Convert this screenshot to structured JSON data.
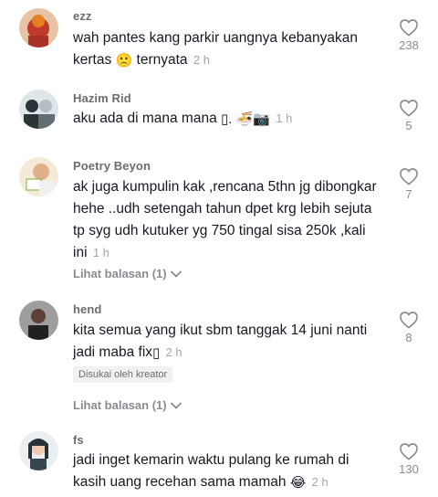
{
  "comments": [
    {
      "username": "ezz",
      "text": "wah pantes kang parkir uangnya kebanyakan kertas",
      "emoji": "🙁",
      "text_after": "ternyata",
      "time": "2 h",
      "likes": "238"
    },
    {
      "username": "Hazim Rid",
      "text": "aku ada di mana mana",
      "emoji": "▯. 🍜📷",
      "time": "1 h",
      "likes": "5"
    },
    {
      "username": "Poetry Beyon",
      "text": "ak juga kumpulin kak ,rencana 5thn jg dibongkar hehe ..udh setengah tahun dpet krg lebih sejuta tp syg udh kutuker yg 750 tingal sisa 250k ,kali ini",
      "time": "1 h",
      "likes": "7",
      "view_replies": "Lihat balasan (1)"
    },
    {
      "username": "hend",
      "text": "kita semua yang ikut sbm tanggak 14 juni nanti jadi maba fix",
      "emoji": "▯",
      "time": "2 h",
      "likes": "8",
      "badge": "Disukai oleh kreator",
      "view_replies": "Lihat balasan (1)"
    },
    {
      "username": "fs",
      "text": "jadi inget kemarin waktu pulang ke rumah di kasih uang recehan sama mamah",
      "emoji": "😂",
      "time": "2 h",
      "likes": "130"
    }
  ],
  "colors": {
    "text": "#161823",
    "muted": "#8a8b91",
    "time": "#a4a5ab"
  },
  "icons": {
    "like": "heart-outline-icon",
    "expand": "chevron-down-icon"
  }
}
